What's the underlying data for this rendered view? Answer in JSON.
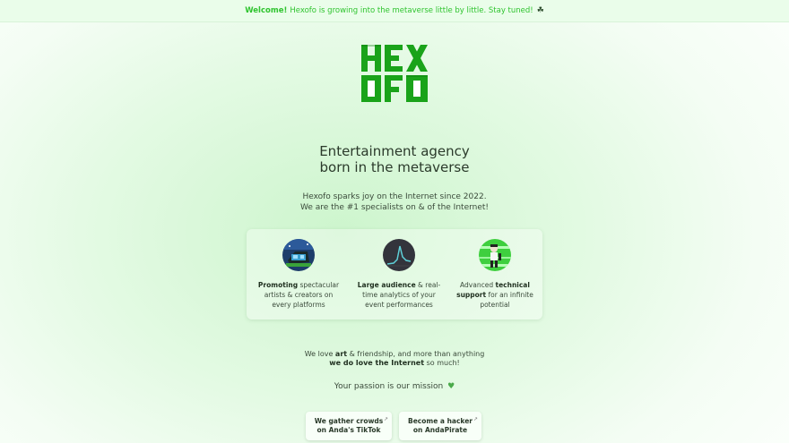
{
  "banner": {
    "strong": "Welcome!",
    "text": "Hexofo is growing into the metaverse little by little. Stay tuned!",
    "icon": "clover-icon"
  },
  "logo": {
    "line1": "HEX",
    "line2": "OFO",
    "color": "#1aa31a"
  },
  "headline": {
    "line1": "Entertainment agency",
    "line2": "born in the metaverse"
  },
  "intro": {
    "line1": "Hexofo sparks joy on the Internet since 2022.",
    "line2": "We are the #1 specialists on & of the Internet!"
  },
  "features": [
    {
      "strong": "Promoting",
      "rest": " spectacular artists & creators on every platforms"
    },
    {
      "strong": "Large audience",
      "rest": " & real-time analytics of your event performances"
    },
    {
      "pre": "Advanced ",
      "strong": "technical support",
      "rest": " for an infinite potential"
    }
  ],
  "love": {
    "a": "We love ",
    "b": "art",
    "c": " & friendship, and more than anything",
    "d": "we do love the Internet",
    "e": " so much!"
  },
  "mission": {
    "text": "Your passion is our mission",
    "icon": "green-heart-icon"
  },
  "buttons": [
    {
      "line1": "We gather crowds",
      "line2": "on Anda's TikTok"
    },
    {
      "line1": "Become a hacker",
      "line2": "on AndaPirate"
    }
  ]
}
